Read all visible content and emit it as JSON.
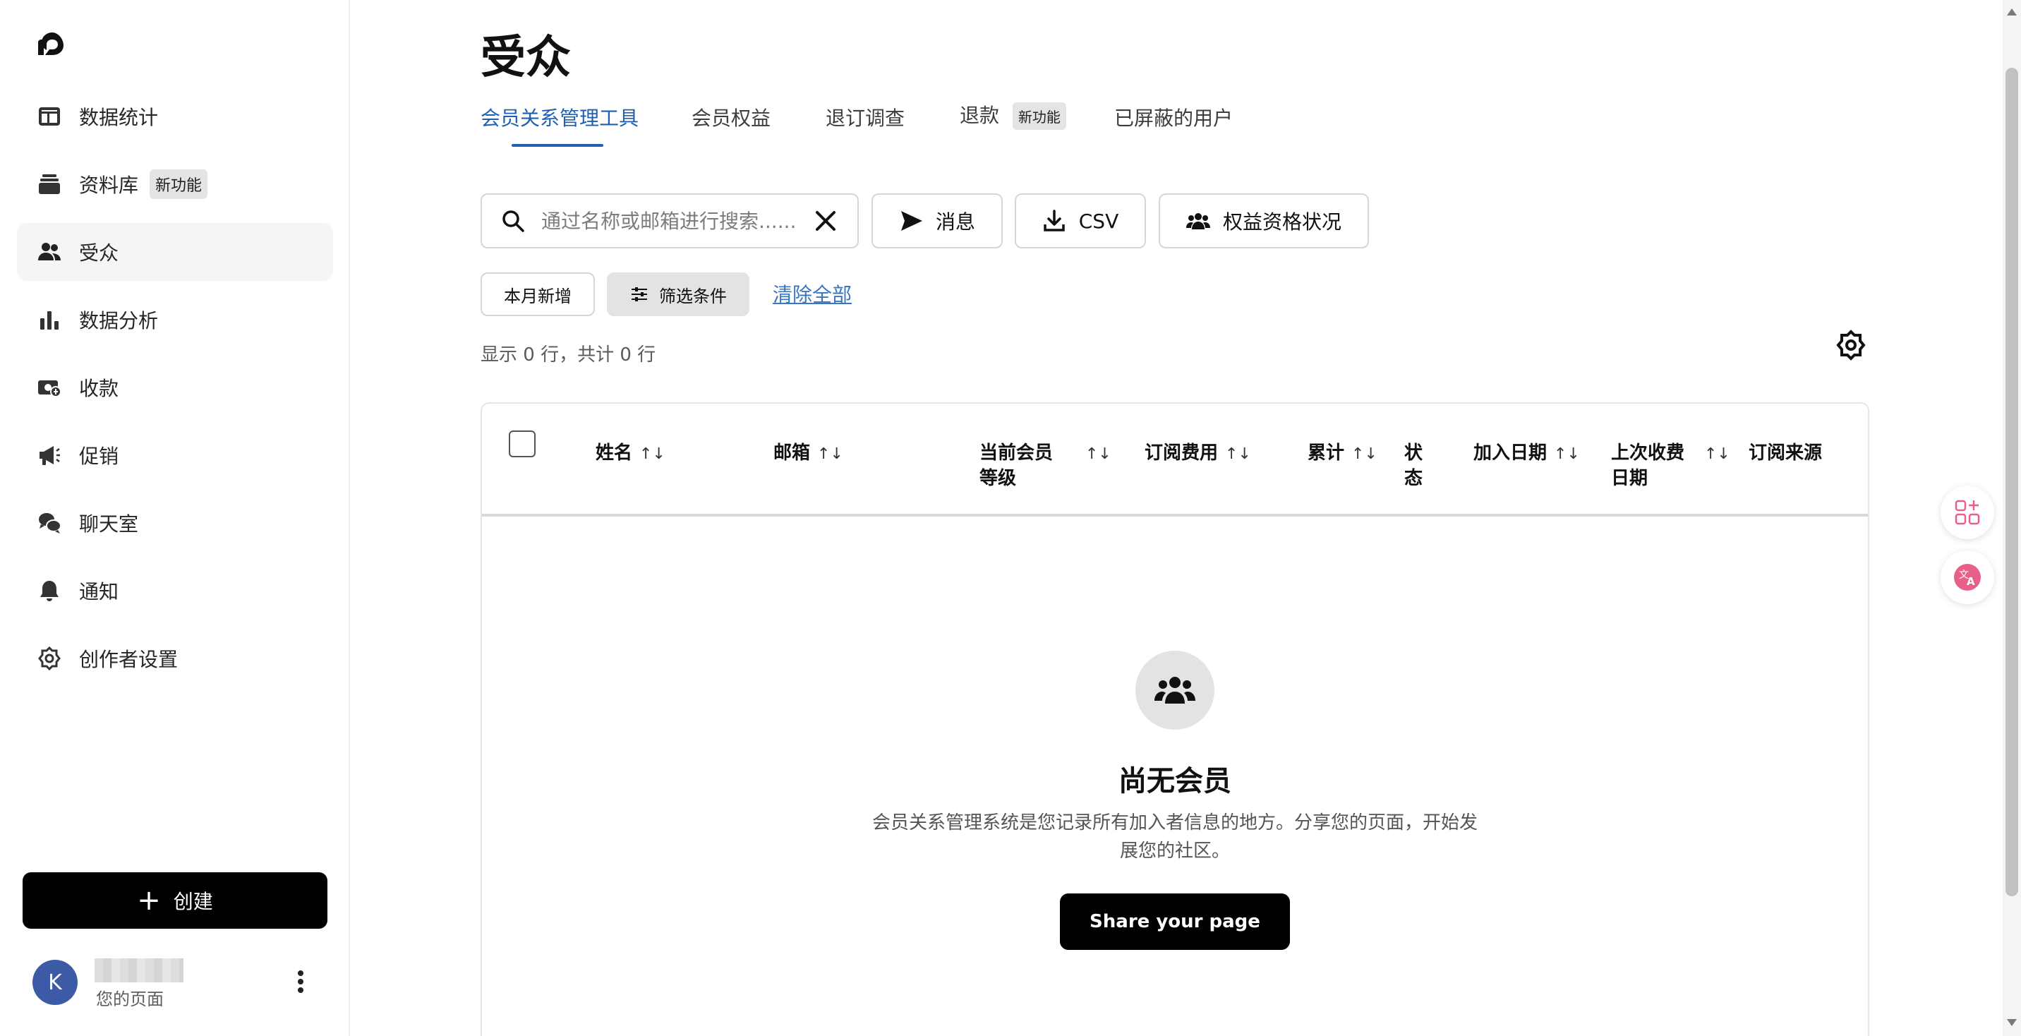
{
  "sidebar": {
    "items": [
      {
        "label": "数据统计",
        "icon": "dashboard-icon"
      },
      {
        "label": "资料库",
        "icon": "library-icon",
        "badge": "新功能"
      },
      {
        "label": "受众",
        "icon": "audience-icon",
        "active": true
      },
      {
        "label": "数据分析",
        "icon": "analytics-icon"
      },
      {
        "label": "收款",
        "icon": "payouts-icon"
      },
      {
        "label": "促销",
        "icon": "promotions-icon"
      },
      {
        "label": "聊天室",
        "icon": "chats-icon"
      },
      {
        "label": "通知",
        "icon": "notifications-icon"
      },
      {
        "label": "创作者设置",
        "icon": "settings-icon"
      }
    ],
    "create_label": "创建",
    "profile": {
      "initial": "K",
      "subtitle": "您的页面"
    }
  },
  "header": {
    "title": "受众"
  },
  "tabs": [
    {
      "label": "会员关系管理工具",
      "active": true
    },
    {
      "label": "会员权益"
    },
    {
      "label": "退订调查"
    },
    {
      "label": "退款",
      "badge": "新功能"
    },
    {
      "label": "已屏蔽的用户"
    }
  ],
  "toolbar": {
    "search_placeholder": "通过名称或邮箱进行搜索......",
    "message_label": "消息",
    "csv_label": "CSV",
    "benefits_label": "权益资格状况"
  },
  "filters": {
    "new_this_month": "本月新增",
    "filter_label": "筛选条件",
    "clear_all": "清除全部"
  },
  "row_count": "显示 0 行，共计 0 行",
  "table": {
    "columns": [
      "姓名",
      "邮箱",
      "当前会员等级",
      "订阅费用",
      "累计",
      "状态",
      "加入日期",
      "上次收费日期",
      "订阅来源"
    ],
    "sort_glyph": "↑↓"
  },
  "empty_state": {
    "title": "尚无会员",
    "description": "会员关系管理系统是您记录所有加入者信息的地方。分享您的页面，开始发展您的社区。",
    "button": "Share your page"
  },
  "colors": {
    "accent": "#1f5fb2",
    "link": "#3a76c4",
    "avatar": "#3d5aa6",
    "translate": "#e8608a"
  }
}
